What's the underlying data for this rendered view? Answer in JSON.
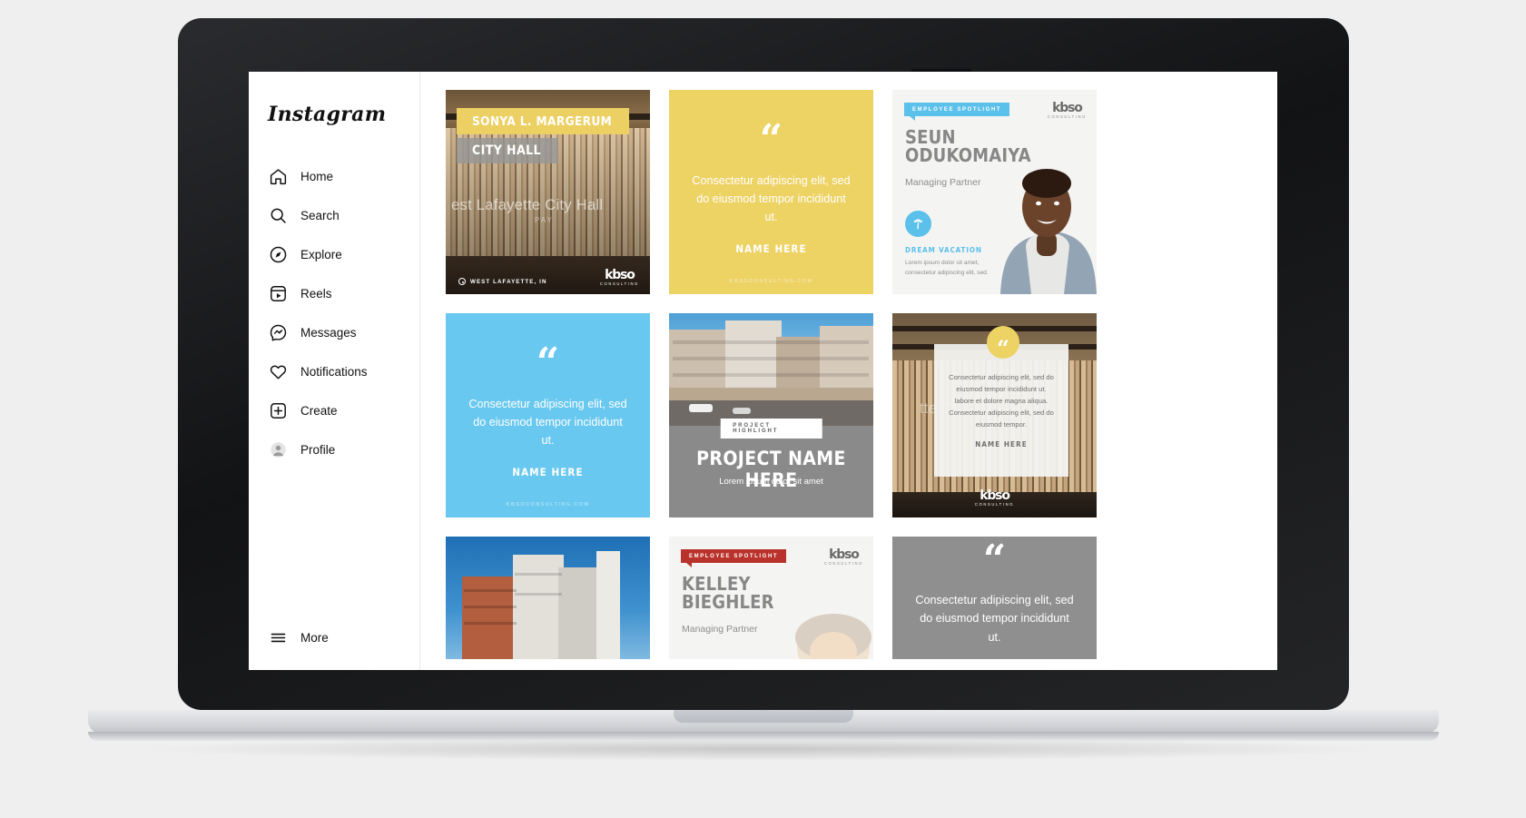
{
  "app": {
    "name": "Instagram"
  },
  "sidebar": {
    "logo": "Instagram",
    "items": [
      {
        "label": "Home",
        "icon": "home-icon"
      },
      {
        "label": "Search",
        "icon": "search-icon"
      },
      {
        "label": "Explore",
        "icon": "compass-icon"
      },
      {
        "label": "Reels",
        "icon": "reels-icon"
      },
      {
        "label": "Messages",
        "icon": "messenger-icon"
      },
      {
        "label": "Notifications",
        "icon": "heart-icon"
      },
      {
        "label": "Create",
        "icon": "plus-square-icon"
      },
      {
        "label": "Profile",
        "icon": "avatar-icon"
      }
    ],
    "more": {
      "label": "More",
      "icon": "hamburger-icon"
    }
  },
  "brand": {
    "name": "kbso",
    "tagline": "CONSULTING",
    "website": "KBSOCONSULTING.COM",
    "colors": {
      "yellow": "#edd264",
      "blue": "#69c8ef",
      "gray": "#8f8f8f",
      "red": "#b9322b"
    }
  },
  "grid": {
    "posts": [
      {
        "id": "post-city-hall",
        "type": "project-photo",
        "band_primary": "SONYA L. MARGERUM",
        "band_secondary": "CITY HALL",
        "ghost_text": "est Lafayette City Hall",
        "ghost_sub": "PAY",
        "location": "WEST LAFAYETTE, IN",
        "logo": "kbso",
        "logo_tagline": "CONSULTING"
      },
      {
        "id": "post-quote-yellow",
        "type": "quote",
        "quote_mark": "“",
        "text": "Consectetur adipiscing elit, sed do eiusmod tempor incididunt ut.",
        "name": "NAME HERE",
        "url": "KBSOCONSULTING.COM",
        "background": "#edd264"
      },
      {
        "id": "post-spotlight-seun",
        "type": "employee-spotlight",
        "tag": "EMPLOYEE SPOTLIGHT",
        "tag_color": "#5bc0ea",
        "name": "SEUN ODUKOMAIYA",
        "role": "Managing Partner",
        "badge_icon": "palm-tree-icon",
        "subheading": "DREAM VACATION",
        "body": "Lorem ipsum dolor sit amet, consectetur adipiscing elit, sed.",
        "logo": "kbso",
        "logo_tagline": "CONSULTING"
      },
      {
        "id": "post-quote-blue",
        "type": "quote",
        "quote_mark": "“",
        "text": "Consectetur adipiscing elit, sed do eiusmod tempor incididunt ut.",
        "name": "NAME HERE",
        "url": "KBSOCONSULTING.COM",
        "background": "#69c8ef"
      },
      {
        "id": "post-project-highlight",
        "type": "project-highlight",
        "tag": "PROJECT HIGHLIGHT",
        "title": "PROJECT NAME HERE",
        "subtitle": "Lorem ipsum dolor sit amet"
      },
      {
        "id": "post-quote-card",
        "type": "quote-card-overlay",
        "quote_mark": "“",
        "text": "Consectetur adipiscing elit, sed do eiusmod tempor incididunt ut. labore et dolore magna aliqua. Consectetur adipiscing elit, sed do eiusmod tempor.",
        "name": "NAME HERE",
        "ghost_text": "tte C",
        "logo": "kbso",
        "logo_tagline": "CONSULTING"
      },
      {
        "id": "post-building-photo",
        "type": "photo",
        "caption": ""
      },
      {
        "id": "post-spotlight-kelley",
        "type": "employee-spotlight",
        "tag": "EMPLOYEE SPOTLIGHT",
        "tag_color": "#b9322b",
        "name": "KELLEY BIEGHLER",
        "role": "Managing Partner",
        "logo": "kbso",
        "logo_tagline": "CONSULTING"
      },
      {
        "id": "post-quote-gray",
        "type": "quote",
        "quote_mark": "“",
        "text": "Consectetur adipiscing elit, sed do eiusmod tempor incididunt ut.",
        "name": "",
        "url": "",
        "background": "#8f8f8f"
      }
    ]
  }
}
